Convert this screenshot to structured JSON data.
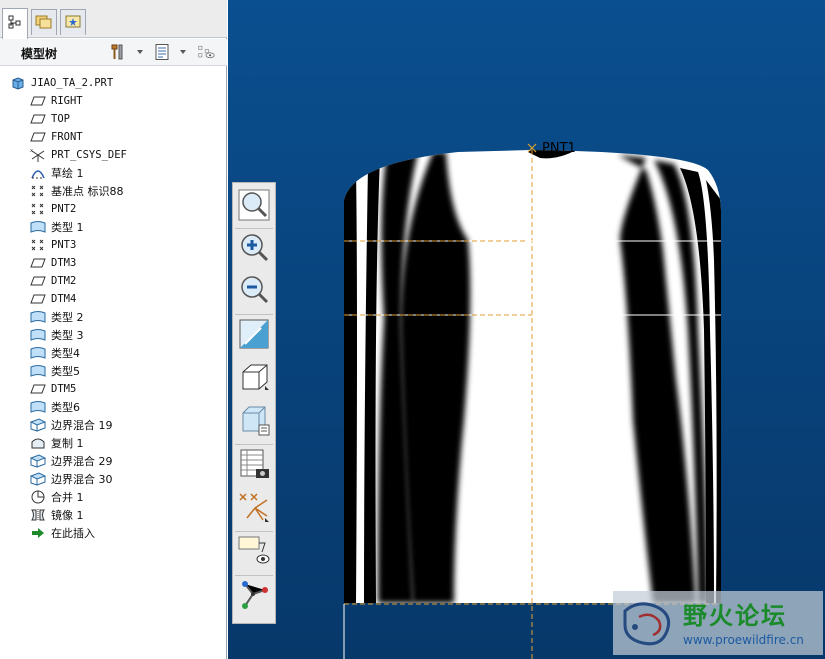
{
  "tabs": [
    {
      "name": "model-tree",
      "icon": "model-tree-icon",
      "active": true
    },
    {
      "name": "folder-browser",
      "icon": "folder-icon",
      "active": false
    },
    {
      "name": "favorites",
      "icon": "favorites-icon",
      "active": false
    }
  ],
  "tree_toolbar": {
    "title": "模型树",
    "icons": [
      "tools-icon",
      "settings-icon",
      "show-hide-icon"
    ]
  },
  "tree": {
    "items": [
      {
        "label": "JIAO_TA_2.PRT",
        "icon": "part-icon"
      },
      {
        "label": "RIGHT",
        "icon": "datum-plane-icon"
      },
      {
        "label": "TOP",
        "icon": "datum-plane-icon"
      },
      {
        "label": "FRONT",
        "icon": "datum-plane-icon"
      },
      {
        "label": "PRT_CSYS_DEF",
        "icon": "csys-icon"
      },
      {
        "label": "草绘 1",
        "icon": "sketch-icon"
      },
      {
        "label": "基准点 标识88",
        "icon": "datum-point-icon"
      },
      {
        "label": "PNT2",
        "icon": "datum-point-icon"
      },
      {
        "label": "类型 1",
        "icon": "style-surface-icon"
      },
      {
        "label": "PNT3",
        "icon": "datum-point-icon"
      },
      {
        "label": "DTM3",
        "icon": "datum-plane-icon"
      },
      {
        "label": "DTM2",
        "icon": "datum-plane-icon"
      },
      {
        "label": "DTM4",
        "icon": "datum-plane-icon"
      },
      {
        "label": "类型 2",
        "icon": "style-surface-icon"
      },
      {
        "label": "类型 3",
        "icon": "style-surface-icon"
      },
      {
        "label": "类型4",
        "icon": "style-surface-icon"
      },
      {
        "label": "类型5",
        "icon": "style-surface-icon"
      },
      {
        "label": "DTM5",
        "icon": "datum-plane-icon"
      },
      {
        "label": "类型6",
        "icon": "style-surface-icon"
      },
      {
        "label": "边界混合 19",
        "icon": "boundary-blend-icon"
      },
      {
        "label": "复制 1",
        "icon": "copy-icon"
      },
      {
        "label": "边界混合 29",
        "icon": "boundary-blend-icon"
      },
      {
        "label": "边界混合 30",
        "icon": "boundary-blend-icon"
      },
      {
        "label": "合并 1",
        "icon": "merge-icon"
      },
      {
        "label": "镜像 1",
        "icon": "mirror-icon"
      },
      {
        "label": "在此插入",
        "icon": "insert-here-arrow-icon"
      }
    ]
  },
  "view_toolbar": {
    "buttons": [
      "zoom-fit-icon",
      "zoom-in-icon",
      "zoom-out-icon",
      "repaint-icon",
      "shading-icon",
      "view-manager-icon",
      "saved-views-icon",
      "datum-display-icon",
      "annotation-display-icon",
      "spin-center-icon"
    ]
  },
  "viewport": {
    "point_label": "PNT1",
    "background_top": "#0a4f90",
    "background_bottom": "#07386a",
    "datum_line_color": "#e0a030"
  },
  "watermark": {
    "title": "野火论坛",
    "url": "www.proewildfire.cn"
  }
}
